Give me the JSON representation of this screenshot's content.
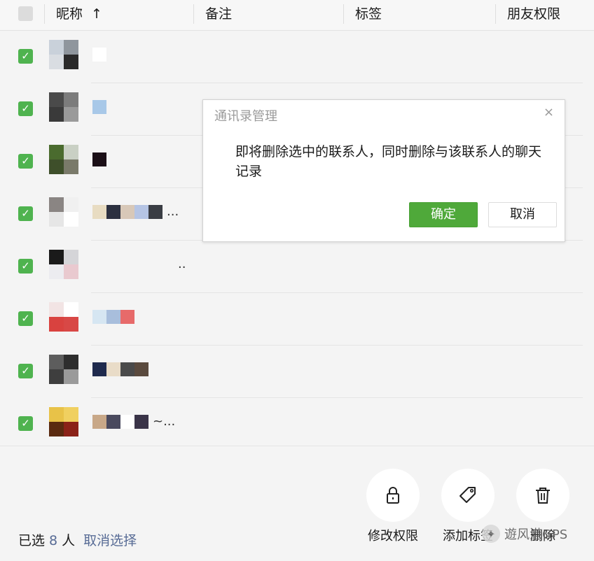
{
  "header": {
    "columns": [
      "昵称",
      "备注",
      "标签",
      "朋友权限"
    ],
    "sort_arrow": "↑"
  },
  "rows": [
    {
      "avatar": [
        "#c9d1da",
        "#8f969d",
        "#d9dde2",
        "#2a2a2a"
      ],
      "nick": [
        "#ffffff"
      ],
      "suffix": ""
    },
    {
      "avatar": [
        "#4a4a4a",
        "#7c7c7c",
        "#3a3a3a",
        "#9a9a9a"
      ],
      "nick": [
        "#a8c8e8"
      ],
      "suffix": ""
    },
    {
      "avatar": [
        "#4a6b2e",
        "#c9d0c4",
        "#3e4f2a",
        "#7a7a6a"
      ],
      "nick": [
        "#1b0f17"
      ],
      "suffix": ""
    },
    {
      "avatar": [
        "#8a8583",
        "#f0f0f0",
        "#e6e6e6",
        "#ffffff"
      ],
      "nick": [
        "#e8dcc2",
        "#2c3040",
        "#d8c8b8",
        "#b5c4e4",
        "#3a3d44"
      ],
      "suffix": "..."
    },
    {
      "avatar": [
        "#1a1a1a",
        "#d5d5d8",
        "#ececf0",
        "#e9c9cf"
      ],
      "nick": [],
      "suffix": ".."
    },
    {
      "avatar": [
        "#f2e4e4",
        "#ffffff",
        "#d9423f",
        "#d84846"
      ],
      "nick": [
        "#d6e6f2",
        "#a8bedc",
        "#e76a6a"
      ],
      "suffix": ""
    },
    {
      "avatar": [
        "#5d5d5d",
        "#2e2e2e",
        "#3e3e3e",
        "#9a9a9a"
      ],
      "nick": [
        "#1f2a4d",
        "#e9dcc8",
        "#4a4a4a",
        "#5a4a3e"
      ],
      "suffix": ""
    },
    {
      "avatar": [
        "#e8c248",
        "#f0d060",
        "#5a2a10",
        "#8a2218"
      ],
      "nick": [
        "#c8a888",
        "#4a4a5e",
        "#ffffff",
        "#3a3448"
      ],
      "suffix": "~..."
    }
  ],
  "footer": {
    "selected_prefix": "已选",
    "selected_count": "8",
    "selected_suffix": "人",
    "cancel_select": "取消选择",
    "actions": [
      "修改权限",
      "添加标签",
      "删除"
    ]
  },
  "dialog": {
    "title": "通讯录管理",
    "close": "×",
    "message": "即将删除选中的联系人，同时删除与该联系人的聊天记录",
    "ok": "确定",
    "cancel": "取消"
  },
  "watermark": "遊风港GPS",
  "colors": {
    "accent_green": "#4fa93a",
    "link_blue": "#576b95",
    "checkbox_green": "#4fb34f"
  },
  "icons": {
    "checkbox": "check-icon",
    "permission": "lock-icon",
    "tag": "tag-icon",
    "delete": "trash-icon",
    "close": "close-icon"
  }
}
